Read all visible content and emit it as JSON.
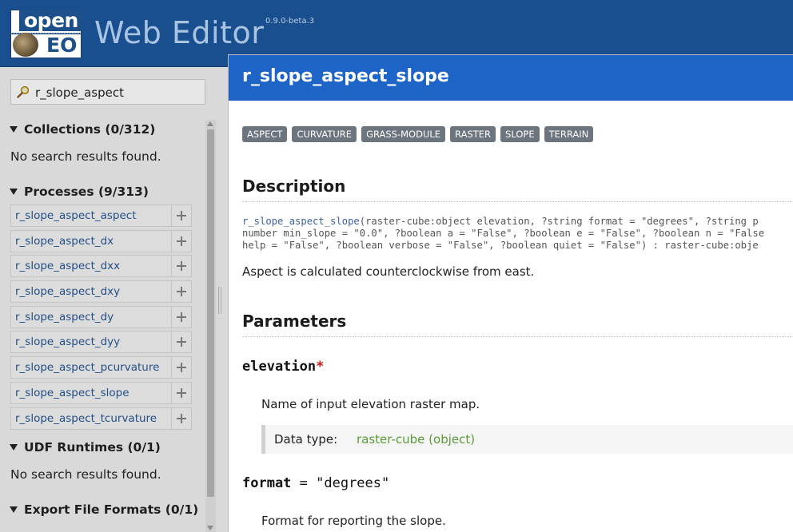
{
  "app": {
    "logo_top": "open",
    "logo_bottom": "EO",
    "title": "Web Editor",
    "version": "0.9.0-beta.3"
  },
  "search": {
    "value": "r_slope_aspect"
  },
  "sidebar": {
    "collections": {
      "title": "Collections (0/312)",
      "empty": "No search results found."
    },
    "processes": {
      "title": "Processes (9/313)",
      "items": [
        "r_slope_aspect_aspect",
        "r_slope_aspect_dx",
        "r_slope_aspect_dxx",
        "r_slope_aspect_dxy",
        "r_slope_aspect_dy",
        "r_slope_aspect_dyy",
        "r_slope_aspect_pcurvature",
        "r_slope_aspect_slope",
        "r_slope_aspect_tcurvature"
      ]
    },
    "udf": {
      "title": "UDF Runtimes (0/1)",
      "empty": "No search results found."
    },
    "export": {
      "title": "Export File Formats (0/1)"
    }
  },
  "doc": {
    "title": "r_slope_aspect_slope",
    "tags": [
      "ASPECT",
      "CURVATURE",
      "GRASS-MODULE",
      "RASTER",
      "SLOPE",
      "TERRAIN"
    ],
    "description_heading": "Description",
    "signature": {
      "fn": "r_slope_aspect_slope",
      "line1_rest": "(raster-cube:object elevation, ?string format = \"degrees\", ?string p",
      "line2": "number min_slope = \"0.0\", ?boolean a = \"False\", ?boolean e = \"False\", ?boolean n = \"False",
      "line3": "help = \"False\", ?boolean verbose = \"False\", ?boolean quiet = \"False\") : raster-cube:obje"
    },
    "description_text": "Aspect is calculated counterclockwise from east.",
    "parameters_heading": "Parameters",
    "params": [
      {
        "name": "elevation",
        "required_mark": "*",
        "description": "Name of input elevation raster map.",
        "data_type_label": "Data type:",
        "data_type_value": "raster-cube (object)"
      },
      {
        "name": "format",
        "default_text": " = \"degrees\"",
        "description": "Format for reporting the slope."
      }
    ]
  }
}
